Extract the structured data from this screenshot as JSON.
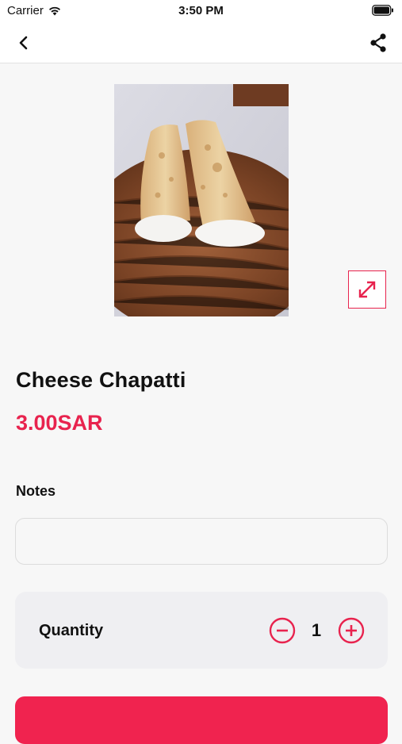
{
  "status_bar": {
    "carrier": "Carrier",
    "time": "3:50 PM"
  },
  "nav": {
    "back_icon": "chevron-left-icon",
    "share_icon": "share-icon"
  },
  "product": {
    "name": "Cheese Chapatti",
    "price": "3.00SAR",
    "image_alt": "chapatti-photo"
  },
  "notes": {
    "label": "Notes",
    "value": "",
    "placeholder": ""
  },
  "quantity": {
    "label": "Quantity",
    "value": "1"
  },
  "colors": {
    "accent": "#e8234e",
    "background": "#f7f7f7"
  }
}
